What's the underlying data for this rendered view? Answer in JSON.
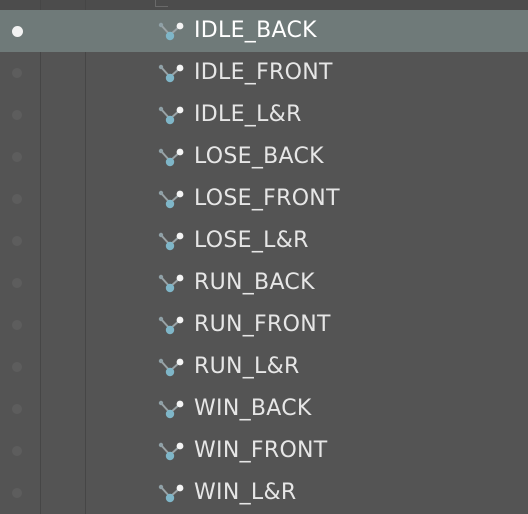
{
  "hierarchy": {
    "rows": [
      {
        "label": "IDLE_BACK",
        "selected": true
      },
      {
        "label": "IDLE_FRONT",
        "selected": false
      },
      {
        "label": "IDLE_L&R",
        "selected": false
      },
      {
        "label": "LOSE_BACK",
        "selected": false
      },
      {
        "label": "LOSE_FRONT",
        "selected": false
      },
      {
        "label": "LOSE_L&R",
        "selected": false
      },
      {
        "label": "RUN_BACK",
        "selected": false
      },
      {
        "label": "RUN_FRONT",
        "selected": false
      },
      {
        "label": "RUN_L&R",
        "selected": false
      },
      {
        "label": "WIN_BACK",
        "selected": false
      },
      {
        "label": "WIN_FRONT",
        "selected": false
      },
      {
        "label": "WIN_L&R",
        "selected": false
      }
    ],
    "row_icon": "bone-node-icon",
    "visibility_icon": "visibility-dot-icon",
    "colors": {
      "background": "#545454",
      "selected_row": "#6f7a79",
      "text": "#e6e6e6",
      "icon_node": "#7fb6c8"
    }
  }
}
